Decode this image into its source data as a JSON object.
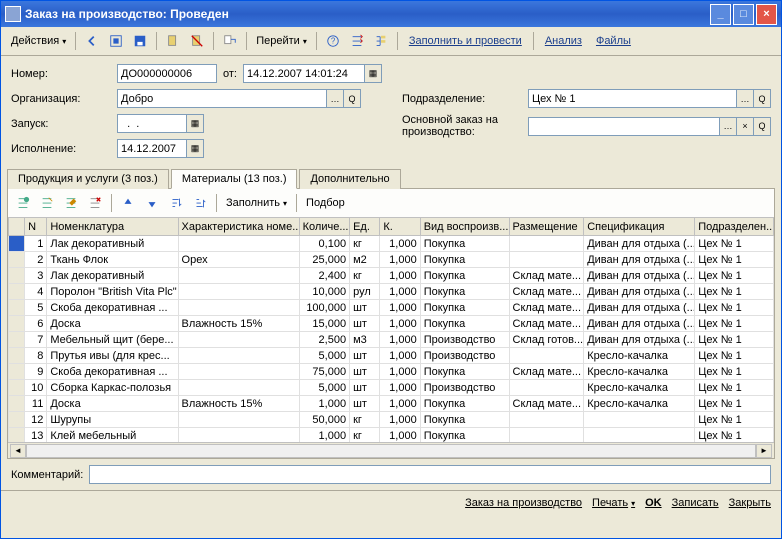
{
  "window": {
    "title": "Заказ на производство: Проведен"
  },
  "toolbar": {
    "actions": "Действия",
    "go": "Перейти",
    "fill_and_post": "Заполнить и провести",
    "analysis": "Анализ",
    "files": "Файлы"
  },
  "form": {
    "number_label": "Номер:",
    "number": "ДО000000006",
    "from_label": "от:",
    "date": "14.12.2007 14:01:24",
    "org_label": "Организация:",
    "org": "Добро",
    "sub_label": "Подразделение:",
    "sub": "Цех № 1",
    "launch_label": "Запуск:",
    "launch": "  .  .    ",
    "mainorder_label": "Основной заказ на производство:",
    "mainorder": "",
    "exec_label": "Исполнение:",
    "exec": "14.12.2007"
  },
  "tabs": {
    "prod": "Продукция и услуги (3 поз.)",
    "mat": "Материалы (13 поз.)",
    "add": "Дополнительно"
  },
  "tab_toolbar": {
    "fill": "Заполнить",
    "select": "Подбор"
  },
  "columns": {
    "n": "N",
    "nom": "Номенклатура",
    "char": "Характеристика номе...",
    "qty": "Количе...",
    "unit": "Ед.",
    "k": "К.",
    "repro": "Вид воспроизв...",
    "place": "Размещение",
    "spec": "Спецификация",
    "subdiv": "Подразделен..."
  },
  "rows": [
    {
      "n": "1",
      "nom": "Лак декоративный",
      "char": "",
      "qty": "0,100",
      "unit": "кг",
      "k": "1,000",
      "repro": "Покупка",
      "place": "",
      "spec": "Диван для отдыха (...",
      "sub": "Цех № 1"
    },
    {
      "n": "2",
      "nom": "Ткань Флок",
      "char": "Орех",
      "qty": "25,000",
      "unit": "м2",
      "k": "1,000",
      "repro": "Покупка",
      "place": "",
      "spec": "Диван для отдыха (...",
      "sub": "Цех № 1"
    },
    {
      "n": "3",
      "nom": "Лак декоративный",
      "char": "",
      "qty": "2,400",
      "unit": "кг",
      "k": "1,000",
      "repro": "Покупка",
      "place": "Склад мате...",
      "spec": "Диван для отдыха (...",
      "sub": "Цех № 1"
    },
    {
      "n": "4",
      "nom": "Поролон \"British Vita Plc\"",
      "char": "",
      "qty": "10,000",
      "unit": "рул",
      "k": "1,000",
      "repro": "Покупка",
      "place": "Склад мате...",
      "spec": "Диван для отдыха (...",
      "sub": "Цех № 1"
    },
    {
      "n": "5",
      "nom": "Скоба декоративная ...",
      "char": "",
      "qty": "100,000",
      "unit": "шт",
      "k": "1,000",
      "repro": "Покупка",
      "place": "Склад мате...",
      "spec": "Диван для отдыха (...",
      "sub": "Цех № 1"
    },
    {
      "n": "6",
      "nom": "Доска",
      "char": "Влажность 15%",
      "qty": "15,000",
      "unit": "шт",
      "k": "1,000",
      "repro": "Покупка",
      "place": "Склад мате...",
      "spec": "Диван для отдыха (...",
      "sub": "Цех № 1"
    },
    {
      "n": "7",
      "nom": "Мебельный щит (бере...",
      "char": "",
      "qty": "2,500",
      "unit": "м3",
      "k": "1,000",
      "repro": "Производство",
      "place": "Склад готов...",
      "spec": "Диван для отдыха (...",
      "sub": "Цех № 1"
    },
    {
      "n": "8",
      "nom": "Прутья ивы (для крес...",
      "char": "",
      "qty": "5,000",
      "unit": "шт",
      "k": "1,000",
      "repro": "Производство",
      "place": "",
      "spec": "Кресло-качалка",
      "sub": "Цех № 1"
    },
    {
      "n": "9",
      "nom": "Скоба декоративная ...",
      "char": "",
      "qty": "75,000",
      "unit": "шт",
      "k": "1,000",
      "repro": "Покупка",
      "place": "Склад мате...",
      "spec": "Кресло-качалка",
      "sub": "Цех № 1"
    },
    {
      "n": "10",
      "nom": "Сборка Каркас-полозья",
      "char": "",
      "qty": "5,000",
      "unit": "шт",
      "k": "1,000",
      "repro": "Производство",
      "place": "",
      "spec": "Кресло-качалка",
      "sub": "Цех № 1"
    },
    {
      "n": "11",
      "nom": "Доска",
      "char": "Влажность 15%",
      "qty": "1,000",
      "unit": "шт",
      "k": "1,000",
      "repro": "Покупка",
      "place": "Склад мате...",
      "spec": "Кресло-качалка",
      "sub": "Цех № 1"
    },
    {
      "n": "12",
      "nom": "Шурупы",
      "char": "",
      "qty": "50,000",
      "unit": "кг",
      "k": "1,000",
      "repro": "Покупка",
      "place": "",
      "spec": "",
      "sub": "Цех № 1"
    },
    {
      "n": "13",
      "nom": "Клей мебельный",
      "char": "",
      "qty": "1,000",
      "unit": "кг",
      "k": "1,000",
      "repro": "Покупка",
      "place": "",
      "spec": "",
      "sub": "Цех № 1"
    }
  ],
  "comment": {
    "label": "Комментарий:",
    "value": ""
  },
  "footer": {
    "zakaz": "Заказ на производство",
    "print": "Печать",
    "ok": "OK",
    "save": "Записать",
    "close": "Закрыть"
  }
}
